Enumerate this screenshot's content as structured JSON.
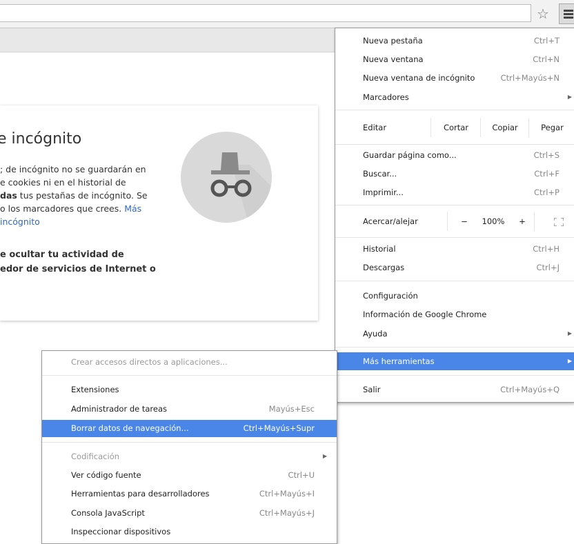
{
  "main_menu": {
    "items": [
      {
        "label": "Nueva pestaña",
        "shortcut": "Ctrl+T"
      },
      {
        "label": "Nueva ventana",
        "shortcut": "Ctrl+N"
      },
      {
        "label": "Nueva ventana de incógnito",
        "shortcut": "Ctrl+Mayús+N"
      },
      {
        "label": "Marcadores",
        "shortcut": ""
      }
    ],
    "edit": {
      "label": "Editar",
      "cut": "Cortar",
      "copy": "Copiar",
      "paste": "Pegar"
    },
    "items2": [
      {
        "label": "Guardar página como...",
        "shortcut": "Ctrl+S"
      },
      {
        "label": "Buscar...",
        "shortcut": "Ctrl+F"
      },
      {
        "label": "Imprimir...",
        "shortcut": "Ctrl+P"
      }
    ],
    "zoom": {
      "label": "Acercar/alejar",
      "minus": "−",
      "value": "100%",
      "plus": "+"
    },
    "items3": [
      {
        "label": "Historial",
        "shortcut": "Ctrl+H"
      },
      {
        "label": "Descargas",
        "shortcut": "Ctrl+J"
      }
    ],
    "items4": [
      {
        "label": "Configuración",
        "shortcut": ""
      },
      {
        "label": "Información de Google Chrome",
        "shortcut": ""
      },
      {
        "label": "Ayuda",
        "shortcut": ""
      }
    ],
    "more_tools": "Más herramientas",
    "exit": {
      "label": "Salir",
      "shortcut": "Ctrl+Mayús+Q"
    }
  },
  "sub_menu": {
    "create_shortcuts": "Crear accesos directos a aplicaciones...",
    "items": [
      {
        "label": "Extensiones",
        "shortcut": ""
      },
      {
        "label": "Administrador de tareas",
        "shortcut": "Mayús+Esc"
      },
      {
        "label": "Borrar datos de navegación...",
        "shortcut": "Ctrl+Mayús+Supr"
      }
    ],
    "encoding": "Codificación",
    "items2": [
      {
        "label": "Ver código fuente",
        "shortcut": "Ctrl+U"
      },
      {
        "label": "Herramientas para desarrolladores",
        "shortcut": "Ctrl+Mayús+I"
      },
      {
        "label": "Consola JavaScript",
        "shortcut": "Ctrl+Mayús+J"
      },
      {
        "label": "Inspeccionar dispositivos",
        "shortcut": ""
      }
    ]
  },
  "incognito_page": {
    "title": "e incógnito",
    "para_lines": [
      "; de incógnito no se guardarán en",
      "e cookies ni en el historial de"
    ],
    "para_bold_start": "das",
    "para_line3_rest": " tus pestañas de incógnito. Se",
    "para_line4": "o los marcadores que crees. ",
    "more_link": "Más",
    "link_line2": " incógnito",
    "bold_lines": [
      "e ocultar tu actividad de",
      "edor de servicios de Internet o"
    ]
  },
  "colors": {
    "highlight": "#4a86e8",
    "link": "#3366cc",
    "icon_circle": "#d9d9d9",
    "icon_dark": "#555555"
  }
}
